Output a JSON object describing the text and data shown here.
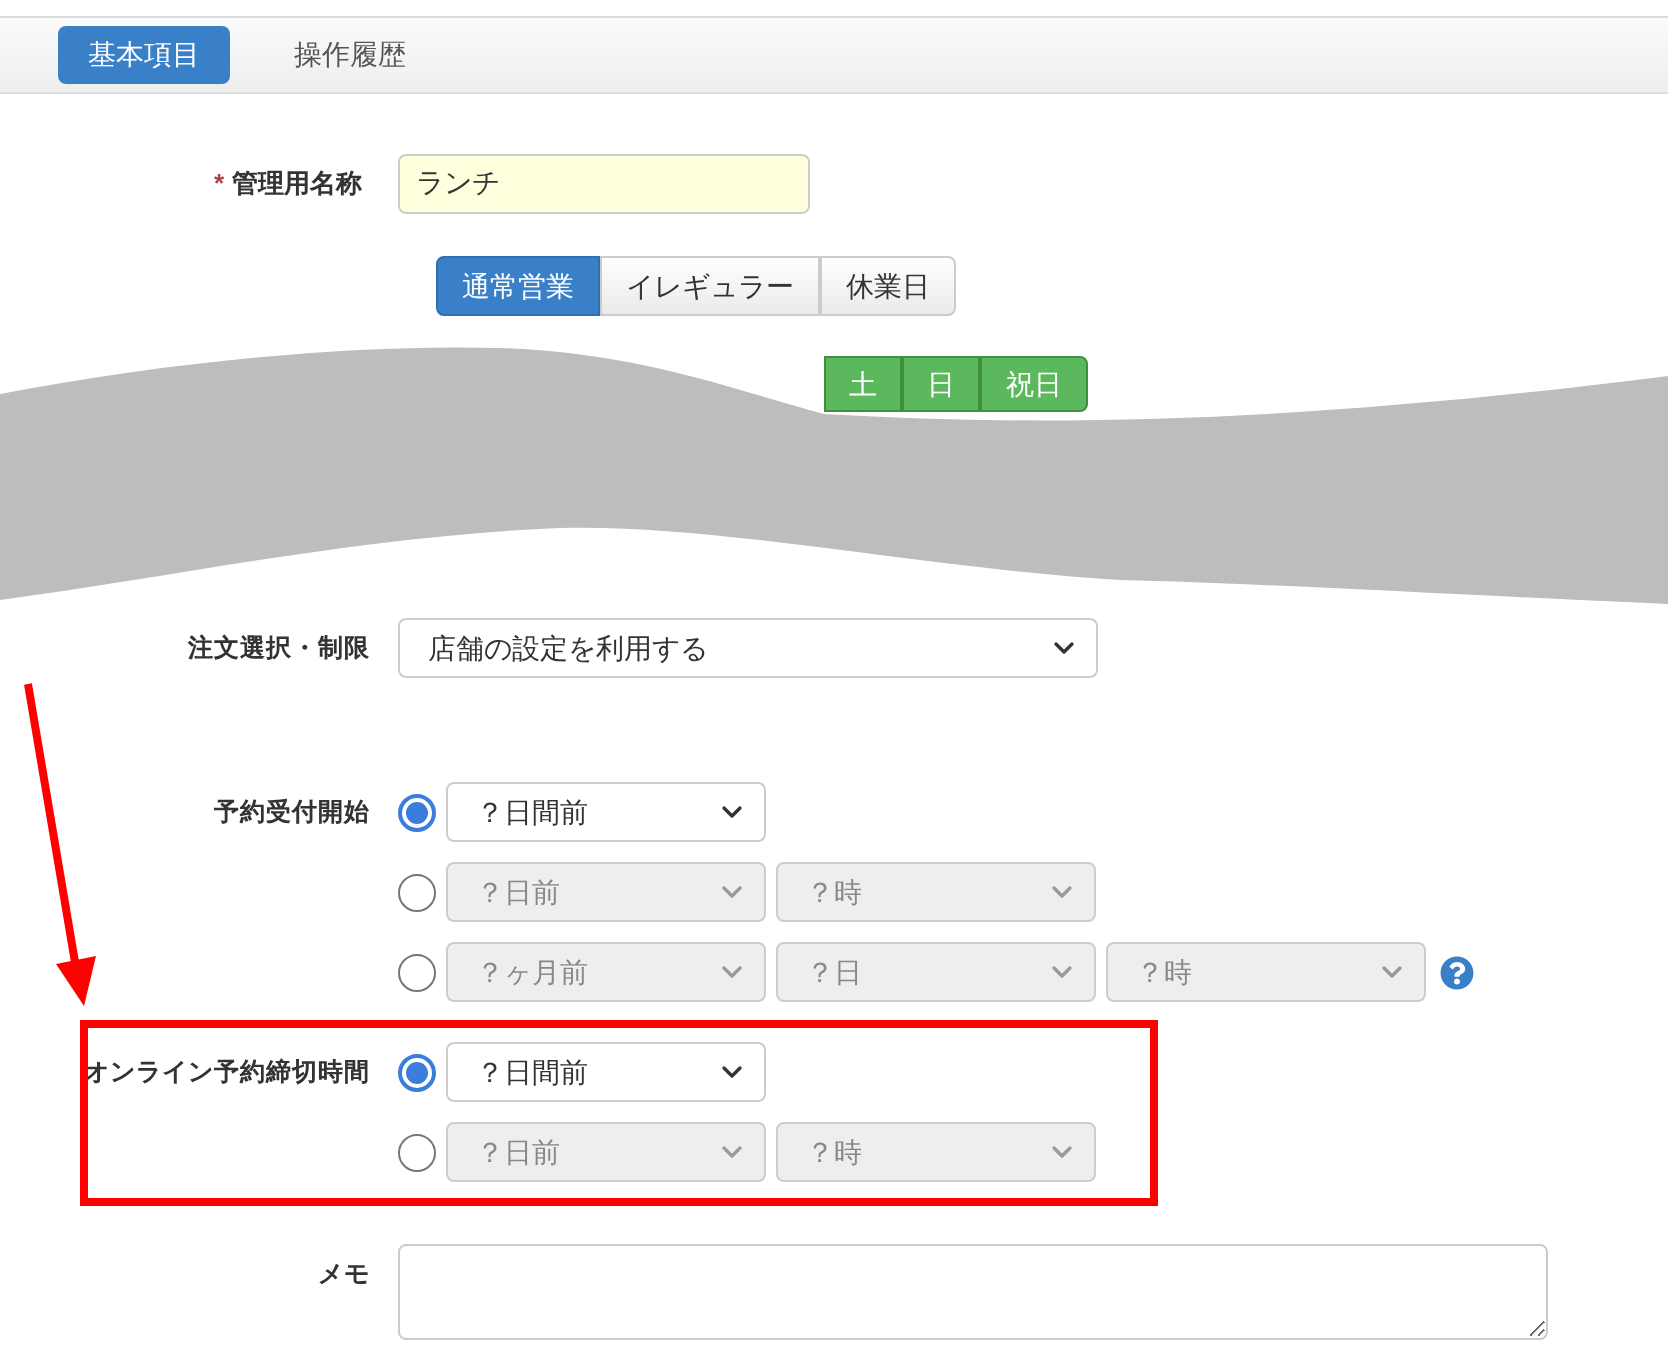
{
  "tabs": [
    {
      "label": "基本項目",
      "selected": true
    },
    {
      "label": "操作履歴",
      "selected": false
    }
  ],
  "name_field": {
    "label": "管理用名称",
    "required_mark": "*",
    "value": "ランチ"
  },
  "business_type": [
    {
      "label": "通常営業",
      "selected": true
    },
    {
      "label": "イレギュラー",
      "selected": false
    },
    {
      "label": "休業日",
      "selected": false
    }
  ],
  "days": [
    {
      "kind": "labeled",
      "label": "土"
    },
    {
      "kind": "labeled",
      "label": "日"
    },
    {
      "kind": "labeled",
      "label": "祝日"
    }
  ],
  "order_limit": {
    "label": "注文選択・制限",
    "value": "店舗の設定を利用する"
  },
  "reservation_start": {
    "label": "予約受付開始",
    "options": [
      {
        "selected": true,
        "selects": [
          {
            "value": "？日間前",
            "disabled": false
          }
        ]
      },
      {
        "selected": false,
        "selects": [
          {
            "value": "？日前",
            "disabled": true
          },
          {
            "value": "？時",
            "disabled": true
          }
        ]
      },
      {
        "selected": false,
        "help": true,
        "selects": [
          {
            "value": "？ヶ月前",
            "disabled": true
          },
          {
            "value": "？日",
            "disabled": true
          },
          {
            "value": "？時",
            "disabled": true
          }
        ]
      }
    ]
  },
  "online_deadline": {
    "label": "オンライン予約締切時間",
    "options": [
      {
        "selected": true,
        "selects": [
          {
            "value": "？日間前",
            "disabled": false
          }
        ]
      },
      {
        "selected": false,
        "selects": [
          {
            "value": "？日前",
            "disabled": true
          },
          {
            "value": "？時",
            "disabled": true
          }
        ]
      }
    ]
  },
  "memo": {
    "label": "メモ"
  }
}
